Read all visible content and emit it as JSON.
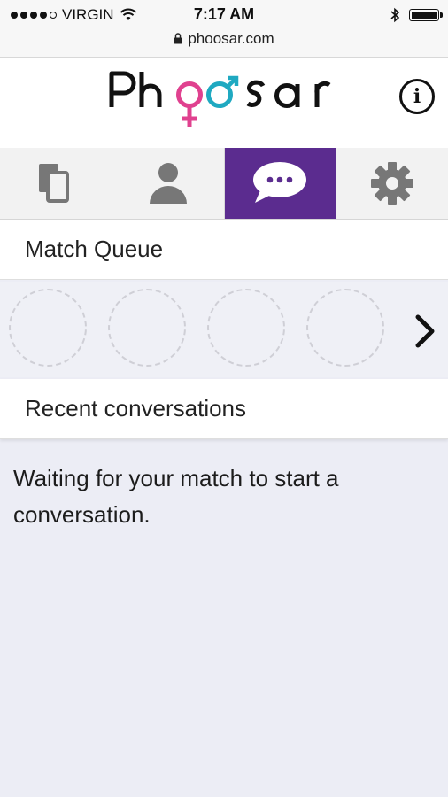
{
  "status_bar": {
    "carrier": "VIRGIN",
    "time": "7:17 AM",
    "url": "phoosar.com",
    "signal_bars_filled": 4,
    "signal_bars_total": 5,
    "battery_level": 1.0
  },
  "header": {
    "logo_text": "Phoosar",
    "logo_colors": {
      "text": "#111111",
      "female_symbol": "#e0418f",
      "male_symbol": "#1fa9c1"
    },
    "info_icon": "info-circle-icon"
  },
  "tabs": [
    {
      "name": "cards",
      "icon": "cards-icon",
      "active": false
    },
    {
      "name": "profile",
      "icon": "person-icon",
      "active": false
    },
    {
      "name": "messages",
      "icon": "chat-bubble-icon",
      "active": true
    },
    {
      "name": "settings",
      "icon": "gear-icon",
      "active": false
    }
  ],
  "colors": {
    "active_tab": "#5b2c8f",
    "background": "#ecedf5"
  },
  "match_queue": {
    "title": "Match Queue",
    "slots": 4,
    "next_icon": "chevron-right-icon"
  },
  "recent": {
    "title": "Recent conversations",
    "empty_message": "Waiting for your match to start a conversation."
  }
}
